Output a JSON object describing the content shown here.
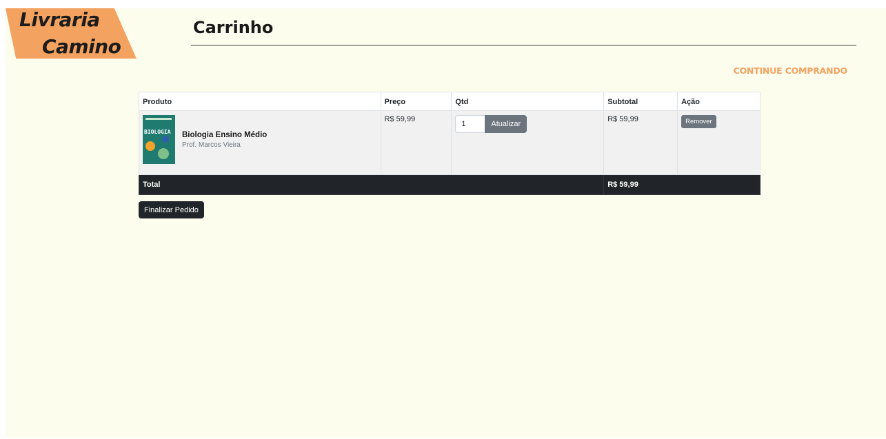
{
  "brand": {
    "line1": "Livraria",
    "line2": "Camino"
  },
  "page": {
    "title": "Carrinho"
  },
  "nav": {
    "continue_label": "CONTINUE COMPRANDO"
  },
  "cart": {
    "headers": {
      "product": "Produto",
      "price": "Preço",
      "qty": "Qtd",
      "subtotal": "Subtotal",
      "action": "Ação"
    },
    "items": [
      {
        "cover_text": "BIOLOGIA",
        "name": "Biologia Ensino Médio",
        "author": "Prof. Marcos Vieira",
        "price": "R$ 59,99",
        "quantity": "1",
        "update_label": "Atualizar",
        "subtotal": "R$ 59,99",
        "remove_label": "Remover"
      }
    ],
    "footer": {
      "total_label": "Total",
      "total_value": "R$ 59,99"
    },
    "checkout_label": "Finalizar Pedido"
  },
  "colors": {
    "accent": "#f4a25f",
    "background": "#fdfdee",
    "dark": "#212529",
    "secondary": "#6c757d"
  }
}
